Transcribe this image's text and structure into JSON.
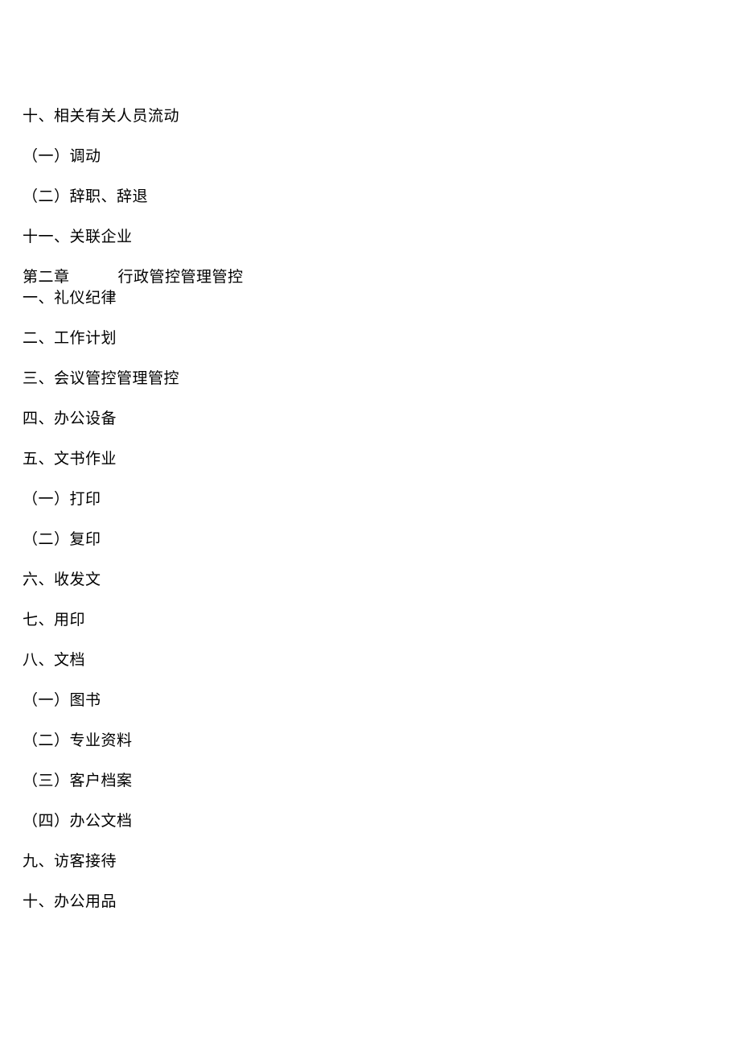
{
  "items": [
    {
      "text": "十、相关有关人员流动"
    },
    {
      "text": "（一）调动"
    },
    {
      "text": "（二）辞职、辞退"
    },
    {
      "text": "十一、关联企业"
    },
    {
      "chapter": true,
      "prefix": "第二章",
      "title": "行政管控管理管控"
    },
    {
      "text": "一、礼仪纪律"
    },
    {
      "text": "二、工作计划"
    },
    {
      "text": "三、会议管控管理管控"
    },
    {
      "text": "四、办公设备"
    },
    {
      "text": "五、文书作业"
    },
    {
      "text": "（一）打印"
    },
    {
      "text": "（二）复印"
    },
    {
      "text": "六、收发文"
    },
    {
      "text": "七、用印"
    },
    {
      "text": "八、文档"
    },
    {
      "text": "（一）图书"
    },
    {
      "text": "（二）专业资料"
    },
    {
      "text": "（三）客户档案"
    },
    {
      "text": "（四）办公文档"
    },
    {
      "text": "九、访客接待"
    },
    {
      "text": "十、办公用品"
    }
  ]
}
